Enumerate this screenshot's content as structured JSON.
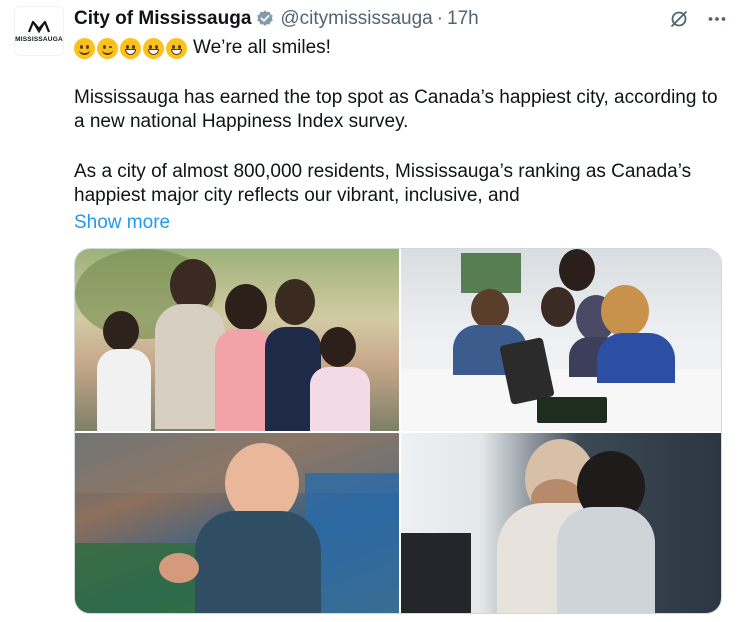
{
  "account": {
    "name": "City of Mississauga",
    "handle": "@citymississauga",
    "separator": "·",
    "time": "17h",
    "avatar_label": "MISSISSAUGA"
  },
  "icons": {
    "verified": "verified-badge-icon",
    "grok": "grok-icon",
    "more": "more-options-icon",
    "emojis": [
      "slightly-smiling-face",
      "winking-face",
      "grinning-face",
      "grinning-squinting-face",
      "grinning-smiling-eyes-face"
    ]
  },
  "post": {
    "headline": "We’re all smiles!",
    "para1": "Mississauga has earned the top spot as Canada’s happiest city, according to a new national Happiness Index survey.",
    "para2": "As a city of almost 800,000 residents, Mississauga’s ranking as Canada’s happiest major city reflects our vibrant, inclusive, and",
    "show_more": "Show more"
  },
  "colors": {
    "text": "#0f1419",
    "muted": "#536471",
    "link": "#1d9bf0",
    "verified": "#829aab",
    "border": "#cfd9de"
  }
}
